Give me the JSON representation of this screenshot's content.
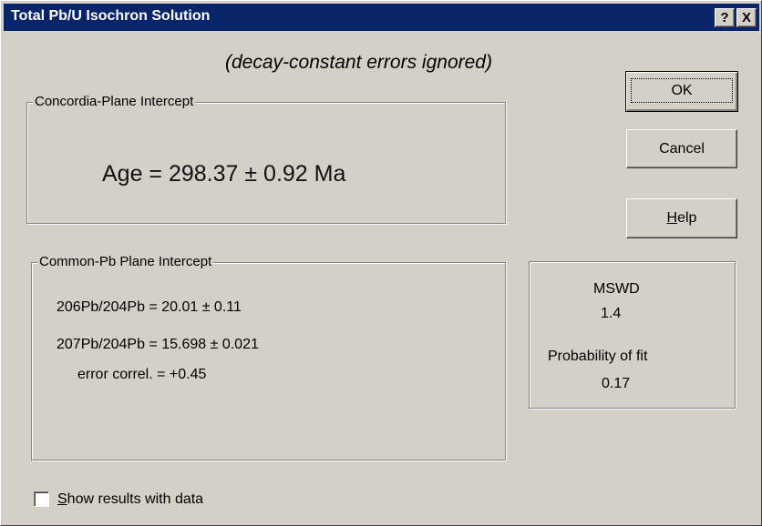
{
  "window": {
    "title": "Total Pb/U Isochron Solution",
    "help_button": "?",
    "close_button": "X"
  },
  "subtitle": "(decay-constant errors ignored)",
  "concordia": {
    "group_label": "Concordia-Plane Intercept",
    "age_text": "Age = 298.37 ± 0.92 Ma"
  },
  "common_pb": {
    "group_label": "Common-Pb Plane Intercept",
    "ratio_206": "206Pb/204Pb = 20.01 ± 0.11",
    "ratio_207": "207Pb/204Pb = 15.698 ± 0.021",
    "error_correl": "error correl. = +0.45"
  },
  "fit": {
    "mswd_label": "MSWD",
    "mswd_value": "1.4",
    "probability_label": "Probability of fit",
    "probability_value": "0.17"
  },
  "buttons": {
    "ok": "OK",
    "cancel": "Cancel",
    "help_first": "H",
    "help_rest": "elp"
  },
  "checkbox": {
    "label_first": "S",
    "label_rest": "how results with data",
    "checked": false
  }
}
